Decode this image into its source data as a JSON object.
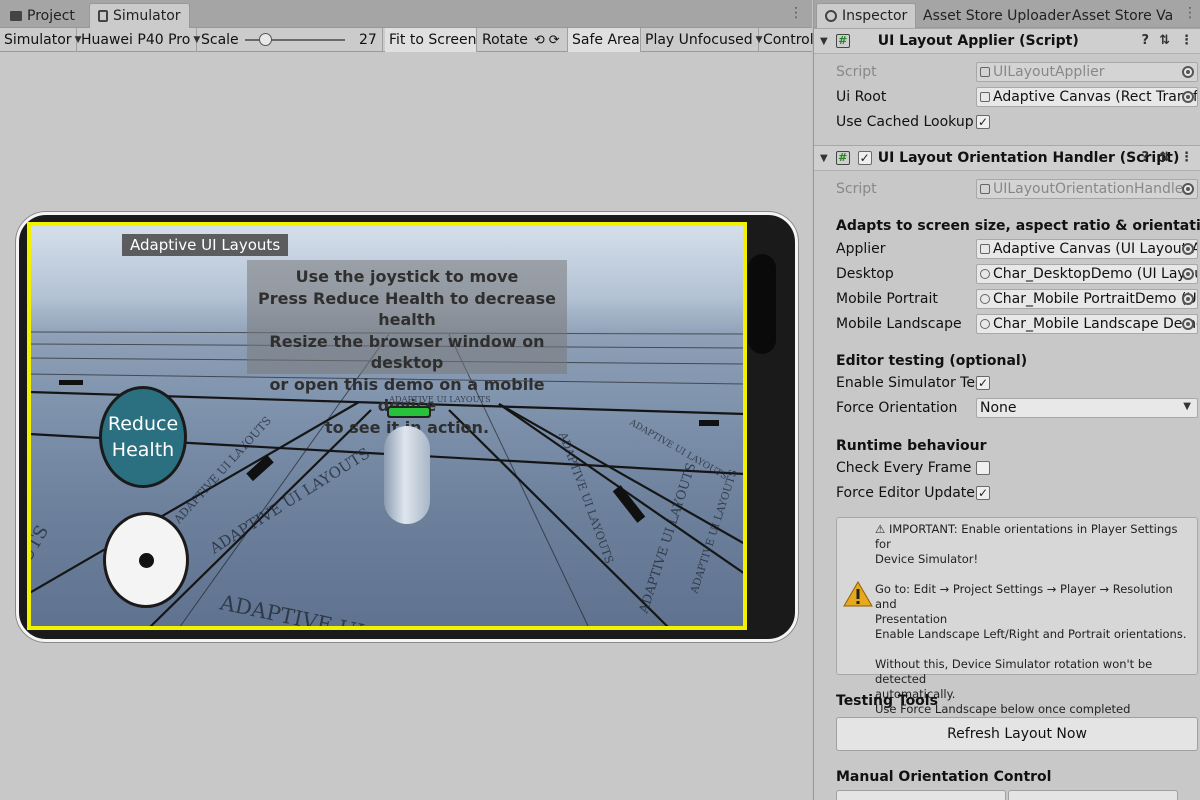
{
  "left_tabs": [
    {
      "label": "Project"
    },
    {
      "label": "Simulator"
    }
  ],
  "toolbar": {
    "mode": "Simulator",
    "device": "Huawei P40 Pro",
    "scale_label": "Scale",
    "scale_value": "27",
    "fit_to_screen": "Fit to Screen",
    "rotate": "Rotate",
    "safe_area": "Safe Area",
    "play_mode": "Play Unfocused",
    "control": "Control"
  },
  "game": {
    "title_label": "Adaptive UI Layouts",
    "instructions": [
      "Use the joystick to move",
      "Press Reduce Health to decrease health",
      "Resize the browser window on desktop",
      "or open this demo on a mobile device",
      "to see it in action."
    ],
    "reduce_button": [
      "Reduce",
      "Health"
    ],
    "health_fraction": 1.0,
    "floor_texts": [
      "ADAPTIVE UI LAYOUTS",
      "ADAPTIVE UI LAYOUTS",
      "ADAPTIVE UI LAYOUTS",
      "ADAPTIVE UI LAYOUTS",
      "ADAPTIVE UI LAYOUTS",
      "ADAPTIVE UI LAYOUTS",
      "ADAPTIVE UI LAYOUTS",
      "ADAPTIVE UI LAYOUTS",
      "UTS"
    ]
  },
  "right_tabs": [
    {
      "label": "Inspector"
    },
    {
      "label": "Asset Store Uploader"
    },
    {
      "label": "Asset Store Va"
    }
  ],
  "applier": {
    "title": "UI Layout Applier (Script)",
    "script_label": "Script",
    "script_value": "UILayoutApplier",
    "ui_root_label": "Ui Root",
    "ui_root_value": "Adaptive Canvas (Rect Transfo",
    "cached_label": "Use Cached Lookup",
    "cached_checked": true
  },
  "handler": {
    "title": "UI Layout Orientation Handler (Script)",
    "enabled": true,
    "script_label": "Script",
    "script_value": "UILayoutOrientationHandler",
    "description": "Adapts to screen size, aspect ratio & orientation — Deskto",
    "applier_label": "Applier",
    "applier_value": "Adaptive Canvas (UI Layout Ap",
    "desktop_label": "Desktop",
    "desktop_value": "Char_DesktopDemo (UI Layout",
    "mobile_portrait_label": "Mobile Portrait",
    "mobile_portrait_value": "Char_Mobile PortraitDemo (UI L",
    "mobile_landscape_label": "Mobile Landscape",
    "mobile_landscape_value": "Char_Mobile Landscape Demo",
    "editor_section": "Editor testing (optional)",
    "enable_sim_label": "Enable Simulator Testir",
    "enable_sim_checked": true,
    "force_orient_label": "Force Orientation",
    "force_orient_value": "None",
    "runtime_section": "Runtime behaviour",
    "check_frame_label": "Check Every Frame",
    "check_frame_checked": false,
    "force_update_label": "Force Editor Update",
    "force_update_checked": true,
    "help_text": "⚠ IMPORTANT: Enable orientations in Player Settings for\nDevice Simulator!\n\nGo to: Edit → Project Settings → Player → Resolution and\nPresentation\nEnable Landscape Left/Right and Portrait orientations.\n\nWithout this, Device Simulator rotation won't be detected\nautomatically.\nUse Force Landscape below once completed",
    "testing_section": "Testing Tools",
    "refresh_button": "Refresh Layout Now",
    "manual_section": "Manual Orientation Control"
  },
  "colors": {
    "safe_area": "#f2f200",
    "reduce_button": "#2a7080",
    "health": "#27c23a"
  }
}
